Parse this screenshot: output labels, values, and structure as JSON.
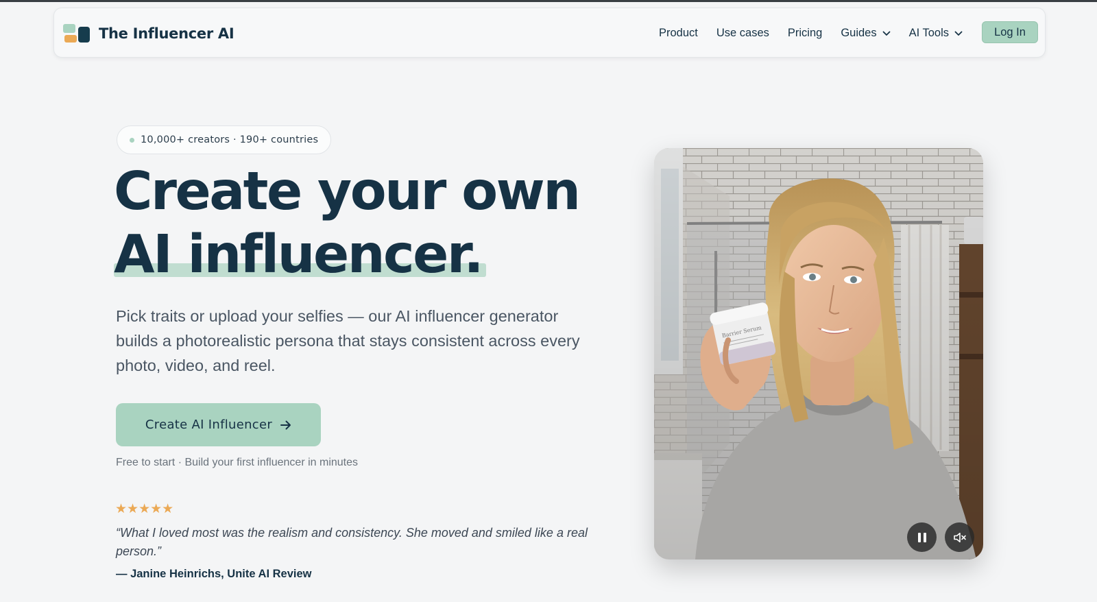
{
  "brand": {
    "name": "The Influencer AI",
    "colors": {
      "mint": "#a9d3c0",
      "orange": "#eba955",
      "navy": "#163245"
    }
  },
  "nav": {
    "links": [
      {
        "label": "Product"
      },
      {
        "label": "Use cases"
      },
      {
        "label": "Pricing"
      },
      {
        "label": "Guides",
        "icon": "chevron-down-icon"
      },
      {
        "label": "AI Tools",
        "icon": "chevron-down-icon"
      }
    ],
    "login_label": "Log In"
  },
  "hero": {
    "badge": "10,000+ creators · 190+ countries",
    "headline_line1": "Create your own",
    "headline_line2": "AI influencer.",
    "subtitle": "Pick traits or upload your selfies — our AI influencer generator builds a photorealistic persona that stays consistent across every photo, video, and reel.",
    "cta_label": "Create AI Influencer",
    "cta_icon": "arrow-right-icon",
    "free_note": "Free to start · Build your first influencer in minutes"
  },
  "review": {
    "rating": 5,
    "stars": "★★★★★",
    "quote": "“What I loved most was the realism and consistency. She moved and smiled like a real person.”",
    "author": "— Janine Heinrichs, Unite AI Review"
  },
  "video": {
    "product_label": "Barrier Serum",
    "controls": {
      "pause_icon": "pause-icon",
      "mute_icon": "speaker-muted-icon"
    }
  }
}
